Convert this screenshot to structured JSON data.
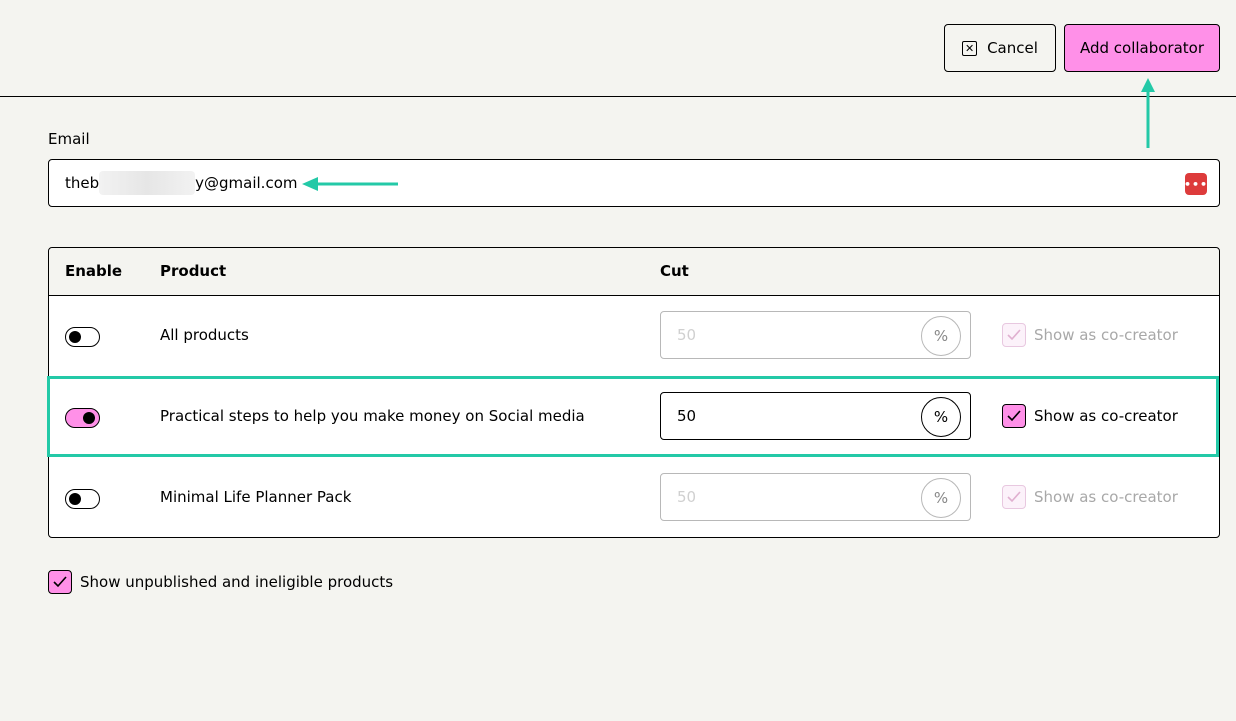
{
  "header": {
    "cancel_label": "Cancel",
    "add_label": "Add collaborator"
  },
  "email": {
    "label": "Email",
    "value_prefix": "theb",
    "value_suffix": "y@gmail.com"
  },
  "table": {
    "headers": [
      "Enable",
      "Product",
      "Cut"
    ],
    "rows": [
      {
        "enabled": false,
        "product": "All products",
        "cut": "50",
        "pct": "%",
        "cocreator": "Show as co-creator",
        "cocreator_checked": true,
        "disabled": true
      },
      {
        "enabled": true,
        "product": "Practical steps to help you make money on Social media",
        "cut": "50",
        "pct": "%",
        "cocreator": "Show as co-creator",
        "cocreator_checked": true,
        "disabled": false
      },
      {
        "enabled": false,
        "product": "Minimal Life Planner Pack",
        "cut": "50",
        "pct": "%",
        "cocreator": "Show as co-creator",
        "cocreator_checked": true,
        "disabled": true
      }
    ]
  },
  "unpublished": {
    "label": "Show unpublished and ineligible products",
    "checked": true
  },
  "colors": {
    "accent_pink": "#ff90e8",
    "annotation_teal": "#23c9a7",
    "background": "#f4f4f0"
  }
}
